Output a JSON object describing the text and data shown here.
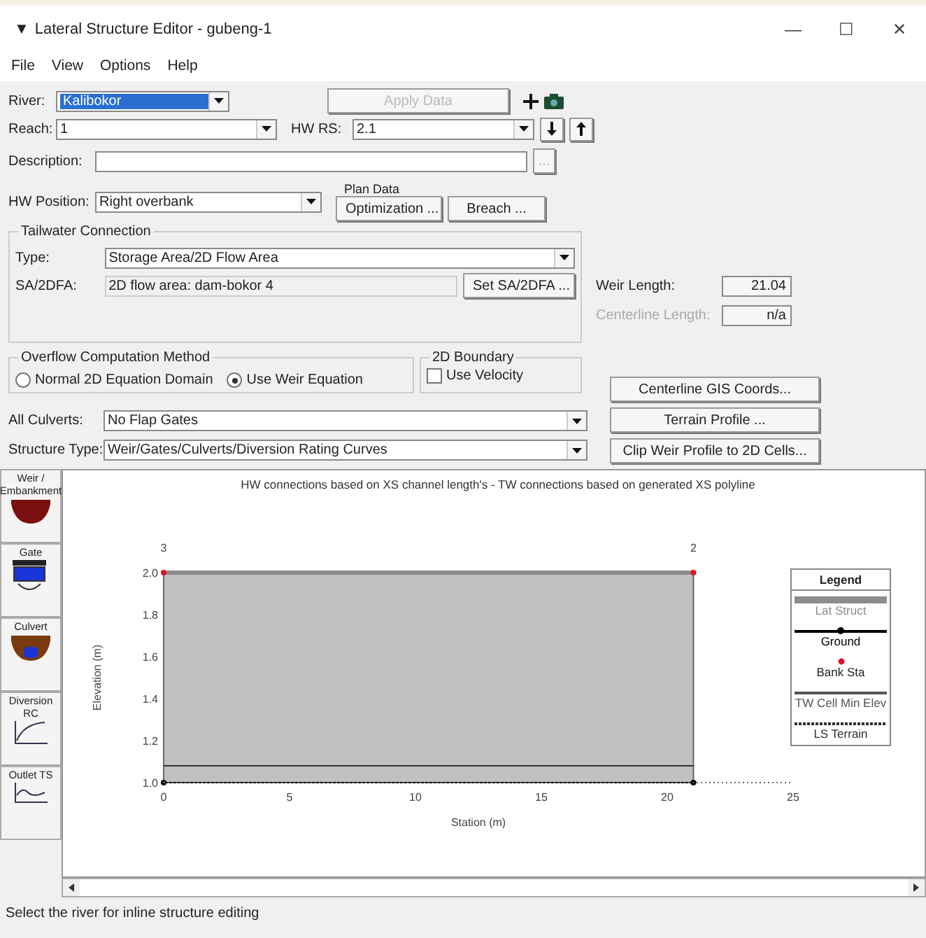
{
  "window": {
    "title": "Lateral Structure Editor - gubeng-1",
    "menu_glyph": "▼",
    "controls": [
      "—",
      "☐",
      "✕"
    ]
  },
  "menu": [
    "File",
    "View",
    "Options",
    "Help"
  ],
  "river": {
    "label": "River:",
    "value": "Kalibokor",
    "selected": true
  },
  "apply_button": {
    "label": "Apply Data",
    "disabled": true
  },
  "reach": {
    "label": "Reach:",
    "value": "1"
  },
  "hw_rs": {
    "label": "HW RS:",
    "value": "2.1"
  },
  "description": {
    "label": "Description:",
    "button": "..."
  },
  "hw_position": {
    "label": "HW Position:",
    "value": "Right overbank"
  },
  "plan_data": {
    "caption": "Plan Data",
    "button": "Optimization ..."
  },
  "breach_button": "Breach ...",
  "tailwater": {
    "title": "Tailwater Connection",
    "type_label": "Type:",
    "type_value": "Storage Area/2D Flow Area",
    "sa_label": "SA/2DFA:",
    "sa_value": "2D flow area: dam-bokor 4",
    "sa_button": "Set SA/2DFA ..."
  },
  "weir_length": {
    "label": "Weir Length:",
    "value": "21.04",
    "disabled": false
  },
  "centerline_length": {
    "label": "Centerline Length:",
    "value": "n/a",
    "disabled": true
  },
  "overflow": {
    "title": "Overflow Computation Method",
    "options": [
      {
        "label": "Normal 2D Equation Domain",
        "selected": false
      },
      {
        "label": "Use Weir Equation",
        "selected": true
      }
    ]
  },
  "boundary": {
    "title": "2D Boundary",
    "label": "Use Velocity",
    "checked": false
  },
  "side_buttons": [
    "Centerline GIS Coords...",
    "Terrain Profile ...",
    "Clip Weir Profile to 2D Cells..."
  ],
  "all_culverts": {
    "label": "All Culverts:",
    "value": "No Flap Gates"
  },
  "structure_type": {
    "label": "Structure Type:",
    "value": "Weir/Gates/Culverts/Diversion Rating Curves"
  },
  "tools": [
    {
      "kind": "weir",
      "label": "Weir / Embankment"
    },
    {
      "kind": "gate",
      "label": "Gate"
    },
    {
      "kind": "culvert",
      "label": "Culvert"
    },
    {
      "kind": "diversion",
      "label": "Diversion RC"
    },
    {
      "kind": "outlet",
      "label": "Outlet TS"
    }
  ],
  "plot": {
    "chart_data": {
      "type": "line",
      "title": "HW connections based on XS channel length's - TW connections based on generated XS polyline",
      "xlabel": "Station (m)",
      "ylabel": "Elevation (m)",
      "x": [
        0,
        21.04
      ],
      "series": [
        {
          "name": "Lat Struct",
          "type": "line",
          "color": "#8c8c8c",
          "values": [
            2.0,
            2.0
          ]
        },
        {
          "name": "Ground",
          "type": "line",
          "color": "#000000",
          "marker": "circle",
          "values": [
            1.0,
            1.0
          ]
        },
        {
          "name": "Bank Sta",
          "type": "scatter",
          "color": "#e0102a",
          "marker": "circle",
          "values": [
            2.0,
            2.0
          ]
        },
        {
          "name": "TW Cell Min Elev",
          "type": "line",
          "color": "#555555",
          "values": [
            null,
            null
          ]
        },
        {
          "name": "LS Terrain",
          "type": "line",
          "color": "#303030",
          "values": [
            1.08,
            1.08
          ]
        }
      ],
      "xlim": [
        0,
        25
      ],
      "ylim": [
        1.0,
        2.0
      ],
      "xticks": [
        0,
        5,
        10,
        15,
        20,
        25
      ],
      "yticks": [
        {
          "value": 1.0,
          "label": "1.0"
        },
        {
          "value": 1.2,
          "label": "1.2"
        },
        {
          "value": 1.4,
          "label": "1.4"
        },
        {
          "value": 1.6,
          "label": "1.6"
        },
        {
          "value": 1.8,
          "label": "1.8"
        },
        {
          "value": 2.0,
          "label": "2.0"
        }
      ],
      "annotations": [
        "3",
        "2"
      ],
      "legend": {
        "title": "Legend"
      }
    }
  },
  "status_bar": "Select the river for inline structure editing"
}
